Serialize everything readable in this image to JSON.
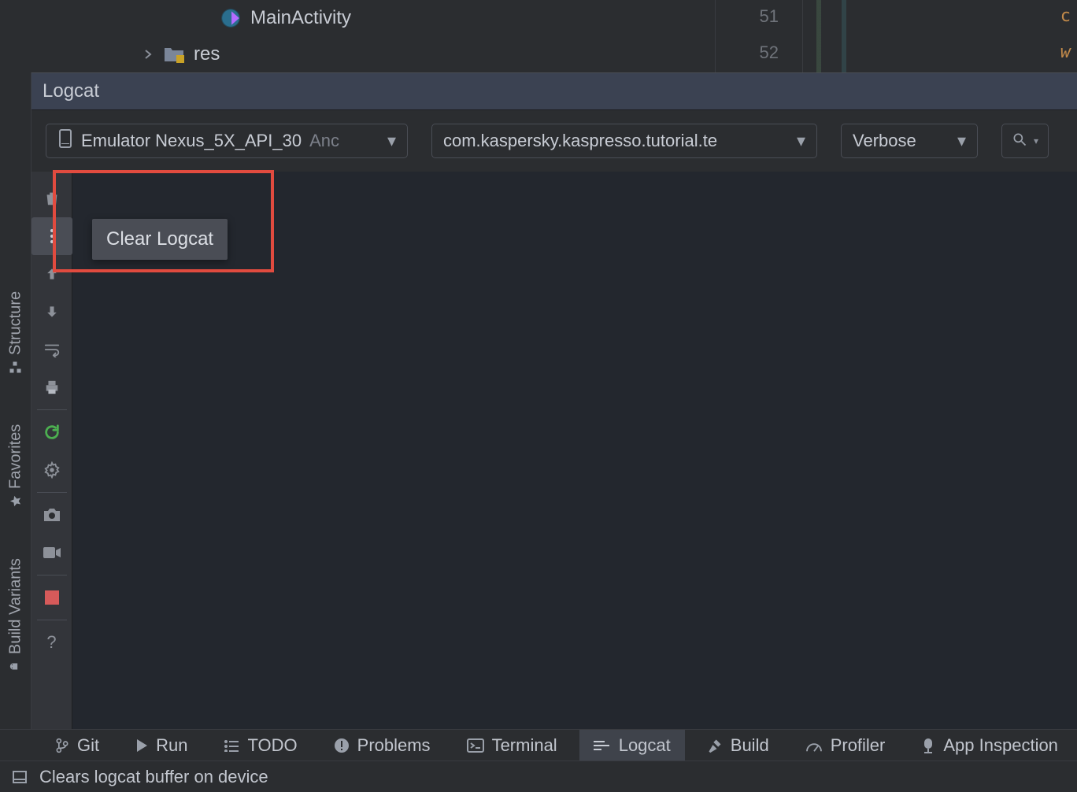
{
  "project": {
    "items": [
      "MainActivity",
      "res"
    ]
  },
  "editor": {
    "line_numbers": [
      "51",
      "52"
    ]
  },
  "left_tabs": {
    "structure": "Structure",
    "favorites": "Favorites",
    "variants": "Build Variants"
  },
  "logcat": {
    "title": "Logcat",
    "device_selector": {
      "text": "Emulator Nexus_5X_API_30",
      "suffix": "Anc"
    },
    "process_selector": "com.kaspersky.kaspresso.tutorial.te",
    "log_level": "Verbose",
    "tooltip": "Clear Logcat"
  },
  "bottom_tabs": {
    "git": "Git",
    "run": "Run",
    "todo": "TODO",
    "problems": "Problems",
    "terminal": "Terminal",
    "logcat": "Logcat",
    "build": "Build",
    "profiler": "Profiler",
    "app_inspection": "App Inspection"
  },
  "status": "Clears logcat buffer on device"
}
